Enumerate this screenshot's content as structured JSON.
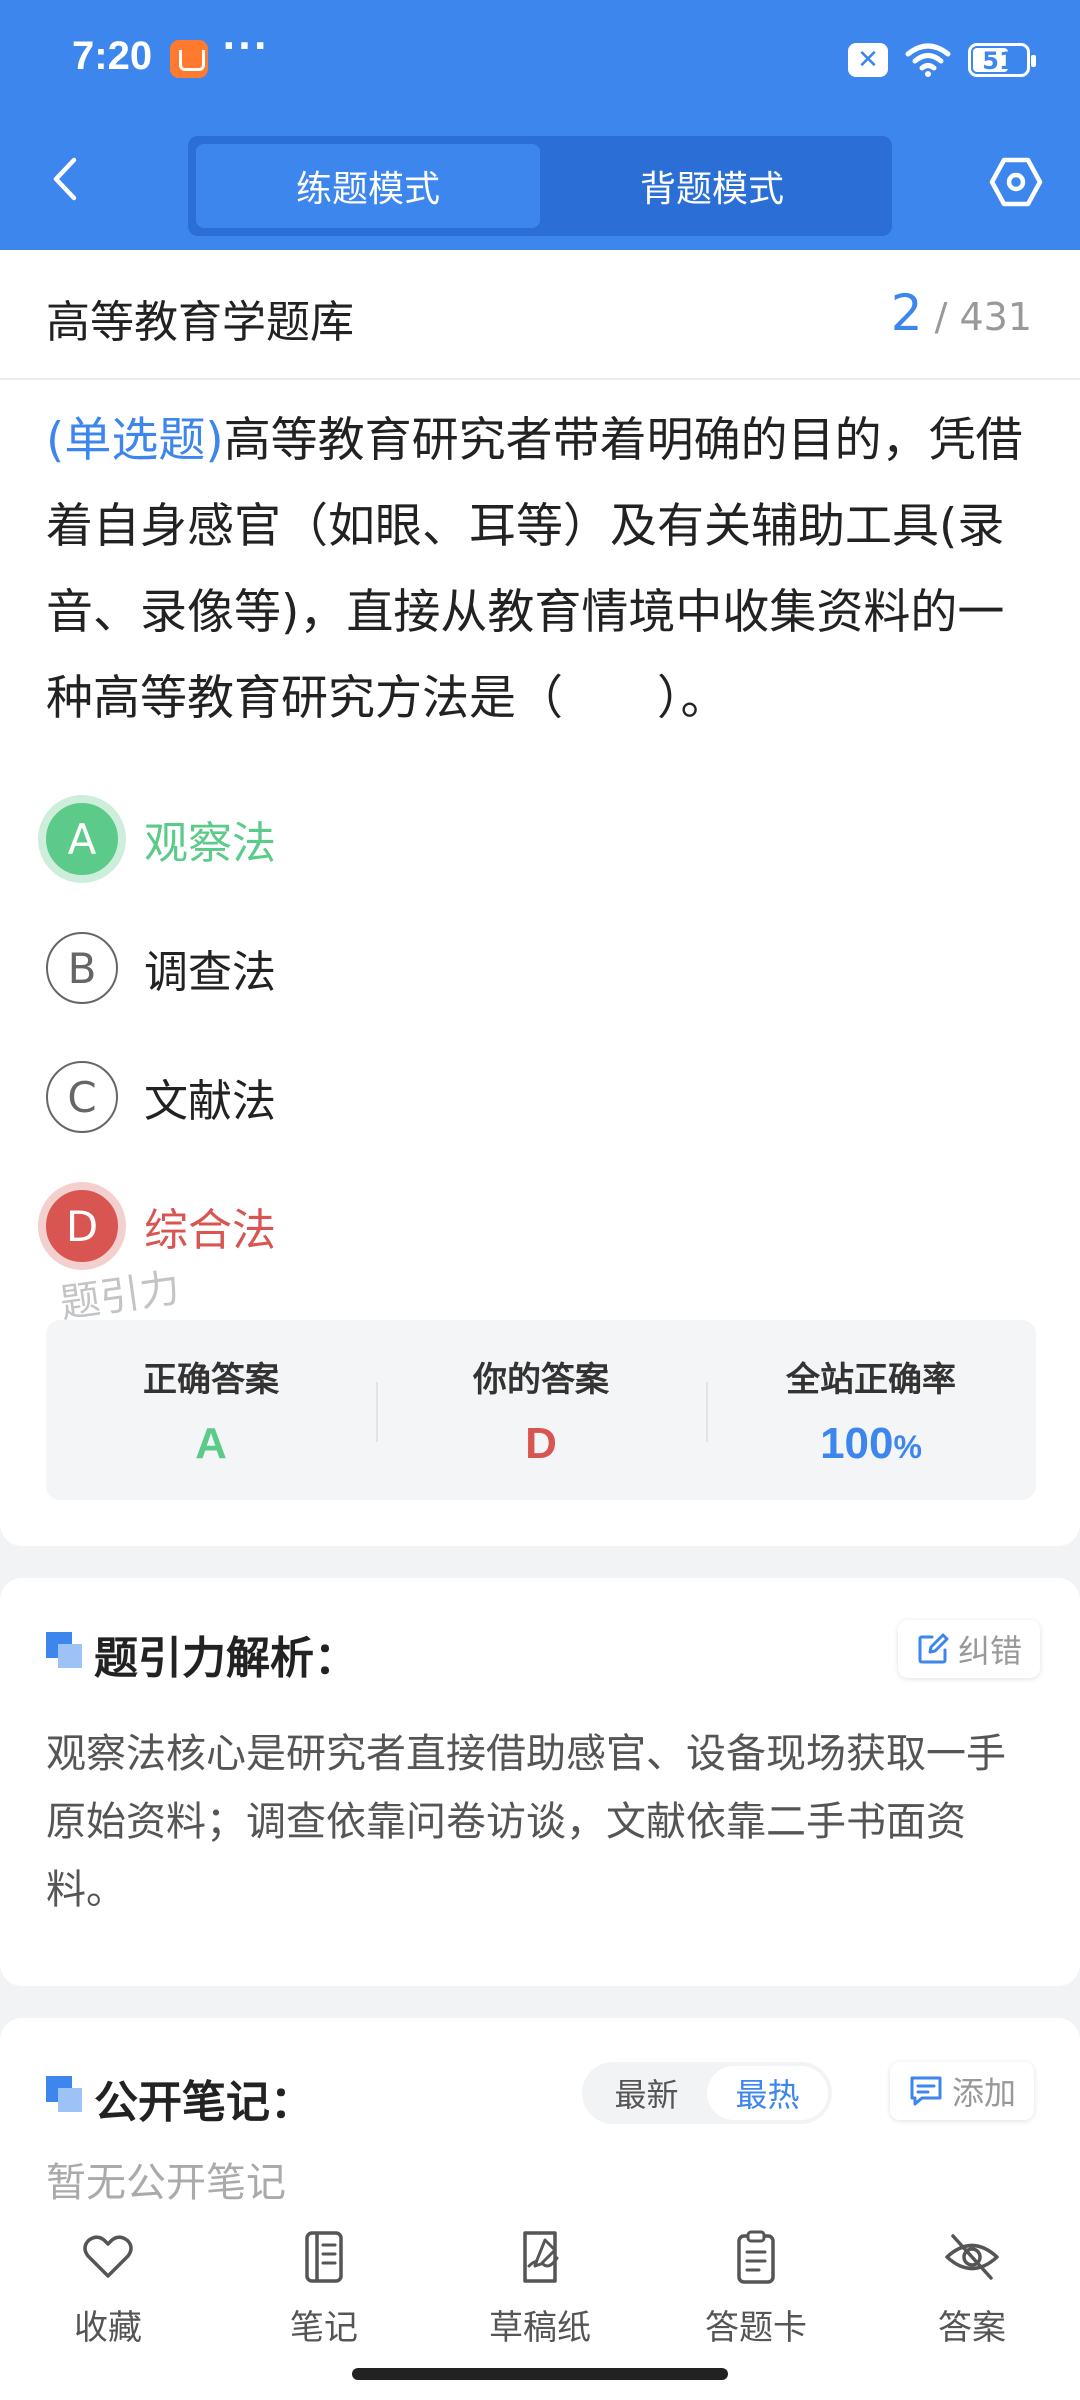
{
  "status_bar": {
    "time": "7:20",
    "more": "···",
    "battery_level": "51"
  },
  "nav": {
    "tabs": [
      {
        "label": "练题模式",
        "active": true
      },
      {
        "label": "背题模式",
        "active": false
      }
    ]
  },
  "bank": {
    "title": "高等教育学题库",
    "current": "2",
    "total": "431"
  },
  "question": {
    "type": "(单选题)",
    "text": "高等教育研究者带着明确的目的，凭借着自身感官（如眼、耳等）及有关辅助工具(录音、录像等)，直接从教育情境中收集资料的一种高等教育研究方法是（　　）。"
  },
  "options": [
    {
      "letter": "A",
      "text": "观察法",
      "state": "correct"
    },
    {
      "letter": "B",
      "text": "调查法",
      "state": "normal"
    },
    {
      "letter": "C",
      "text": "文献法",
      "state": "normal"
    },
    {
      "letter": "D",
      "text": "综合法",
      "state": "wrong"
    }
  ],
  "watermark": "题引力",
  "answer_summary": {
    "correct_label": "正确答案",
    "correct_value": "A",
    "yours_label": "你的答案",
    "yours_value": "D",
    "rate_label": "全站正确率",
    "rate_value": "100",
    "rate_unit": "%"
  },
  "analysis": {
    "title": "题引力解析：",
    "report_label": "纠错",
    "text": "观察法核心是研究者直接借助感官、设备现场获取一手原始资料；调查依靠问卷访谈，文献依靠二手书面资料。"
  },
  "notes": {
    "title": "公开笔记：",
    "sort_options": [
      {
        "label": "最新",
        "active": false
      },
      {
        "label": "最热",
        "active": true
      }
    ],
    "add_label": "添加",
    "empty_text": "暂无公开笔记"
  },
  "bottom_tabs": [
    {
      "label": "收藏",
      "icon": "heart-icon"
    },
    {
      "label": "笔记",
      "icon": "notebook-icon"
    },
    {
      "label": "草稿纸",
      "icon": "draft-icon"
    },
    {
      "label": "答题卡",
      "icon": "clipboard-icon"
    },
    {
      "label": "答案",
      "icon": "eye-off-icon"
    }
  ],
  "colors": {
    "primary": "#3d86ee",
    "correct": "#5ccb8a",
    "wrong": "#d95552"
  }
}
